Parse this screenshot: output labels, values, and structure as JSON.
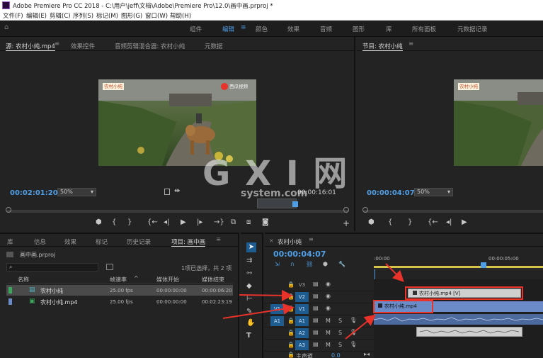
{
  "window": {
    "title": "Adobe Premiere Pro CC 2018 - C:\\用户\\jeff\\文档\\Adobe\\Premiere Pro\\12.0\\画中画.prproj *"
  },
  "menubar": [
    "文件(F)",
    "编辑(E)",
    "剪辑(C)",
    "序列(S)",
    "标记(M)",
    "图形(G)",
    "窗口(W)",
    "帮助(H)"
  ],
  "workspaces": [
    "组件",
    "编辑",
    "颜色",
    "效果",
    "音频",
    "图形",
    "库",
    "所有面板",
    "元数据记录"
  ],
  "workspace_active": "编辑",
  "source_panel": {
    "tabs": [
      "源: 农村小纯.mp4",
      "效果控件",
      "音频剪辑混合器: 农村小纯",
      "元数据"
    ],
    "timecode": "00:02:01:20",
    "zoom": "50%",
    "duration": "00:00:16:01",
    "fit": "完整"
  },
  "program_panel": {
    "tab": "节目: 农村小纯",
    "timecode": "00:00:04:07",
    "zoom": "50%"
  },
  "video_overlay": {
    "channel_text": "农村小纯",
    "logo_text": "西瓜视频"
  },
  "watermark": {
    "main": "G X I 网",
    "sub": "system.com"
  },
  "project_panel": {
    "tabs": [
      "库",
      "信息",
      "效果",
      "标记",
      "历史记录",
      "项目: 画中画"
    ],
    "project_file": "画中画.prproj",
    "selection_status": "1项已选择，共 2 项",
    "columns": [
      "名称",
      "帧速率",
      "媒体开始",
      "媒体结束"
    ],
    "rows": [
      {
        "name": "农村小纯",
        "fps": "25.00 fps",
        "start": "00:00:00:00",
        "end": "00:00:06:20"
      },
      {
        "name": "农村小纯.mp4",
        "fps": "25.00 fps",
        "start": "00:00:00:00",
        "end": "00:02:23:19"
      }
    ]
  },
  "timeline": {
    "tab": "农村小纯",
    "timecode": "00:00:04:07",
    "ruler": [
      ":00:00",
      "00:00:05:00"
    ],
    "tracks_video": [
      "V3",
      "V2",
      "V1"
    ],
    "tracks_audio": [
      "A1",
      "A2",
      "A3"
    ],
    "master": "主声道",
    "master_value": "0.0",
    "clip_v2": "农村小纯.mp4 [V]",
    "clip_v1": "农村小纯.mp4",
    "audio_letters": [
      "M",
      "S"
    ]
  },
  "tools": [
    "selection",
    "track-select",
    "ripple-edit",
    "razor",
    "slip",
    "pen",
    "hand",
    "type"
  ],
  "colors": {
    "accent": "#4f9fe8",
    "annotation": "#e8322a",
    "clip": "#6a8bc7"
  }
}
